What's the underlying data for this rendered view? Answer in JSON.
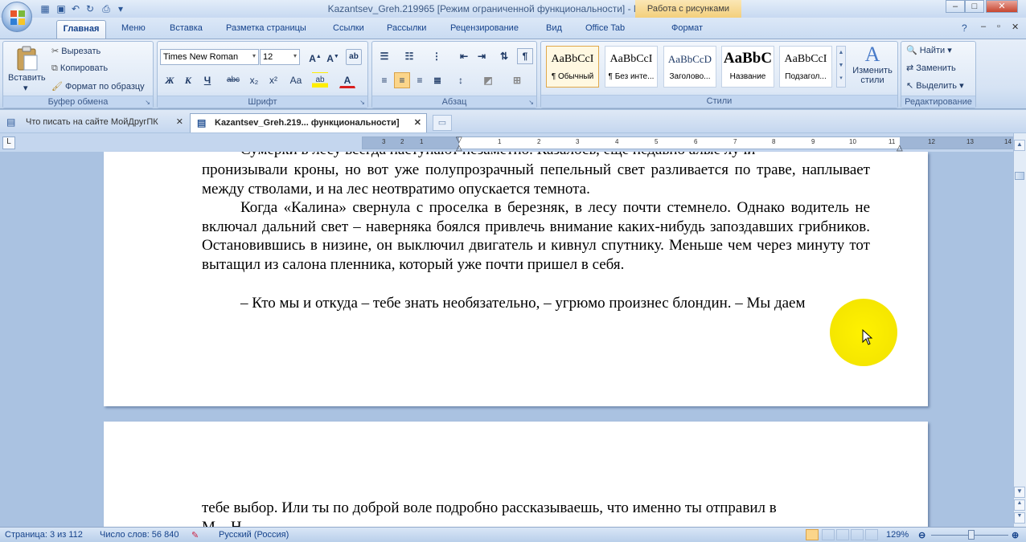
{
  "window": {
    "title": "Kazantsev_Greh.219965 [Режим ограниченной функциональности] - Microsoft Word",
    "context_tab": "Работа с рисунками",
    "controls": [
      "–",
      "□",
      "✕"
    ]
  },
  "ribbon_tabs": [
    "Главная",
    "Меню",
    "Вставка",
    "Разметка страницы",
    "Ссылки",
    "Рассылки",
    "Рецензирование",
    "Вид",
    "Office Tab",
    "Формат"
  ],
  "clipboard": {
    "paste": "Вставить",
    "cut": "Вырезать",
    "copy": "Копировать",
    "format_painter": "Формат по образцу",
    "label": "Буфер обмена"
  },
  "font": {
    "name": "Times New Roman",
    "size": "12",
    "label": "Шрифт",
    "buttons": [
      "Ж",
      "К",
      "Ч",
      "abc",
      "x₂",
      "x²",
      "Aa"
    ]
  },
  "paragraph": {
    "label": "Абзац"
  },
  "styles": {
    "items": [
      {
        "preview": "AaBbCcI",
        "name": "¶ Обычный"
      },
      {
        "preview": "AaBbCcI",
        "name": "¶ Без инте..."
      },
      {
        "preview": "AaBbCcD",
        "name": "Заголово..."
      },
      {
        "preview": "AaBbC",
        "name": "Название"
      },
      {
        "preview": "AaBbCcI",
        "name": "Подзагол..."
      }
    ],
    "change": "Изменить стили",
    "label": "Стили"
  },
  "editing": {
    "find": "Найти",
    "replace": "Заменить",
    "select": "Выделить",
    "label": "Редактирование"
  },
  "doc_tabs": [
    "Что писать на сайте МойДругПК",
    "Kazantsev_Greh.219... функциональности]"
  ],
  "ruler": {
    "left_label": "L",
    "numbers": [
      "3",
      "2",
      "1",
      "1",
      "2",
      "3",
      "4",
      "5",
      "6",
      "7",
      "8",
      "9",
      "10",
      "11",
      "12",
      "13",
      "14"
    ]
  },
  "page1": {
    "partial_line": "Сумерки в лесу всегда наступают незаметно. Казалось, еще недавно алые лучи",
    "p1": "пронизывали кроны, но вот уже полупрозрачный пепельный свет разливается по траве, наплывает между стволами, и на лес неотвратимо опускается темнота.",
    "p2": "Когда «Калина» свернула с проселка в березняк, в лесу почти стемнело. Однако водитель не включал дальний свет – наверняка боялся привлечь внимание каких-нибудь запоздавших грибников. Остановившись в низине, он выключил двигатель и кивнул спутнику. Меньше чем через минуту тот вытащил из салона пленника, который уже почти пришел в себя.",
    "p3": "– Кто мы и откуда – тебе знать необязательно, – угрюмо произнес блондин. – Мы даем"
  },
  "page2": {
    "p1": "тебе выбор. Или ты по доброй воле подробно рассказываешь, что именно ты отправил в",
    "p1_cut": "М... Н..."
  },
  "status": {
    "page": "Страница: 3 из 112",
    "words": "Число слов: 56 840",
    "language": "Русский (Россия)",
    "zoom": "129%"
  }
}
